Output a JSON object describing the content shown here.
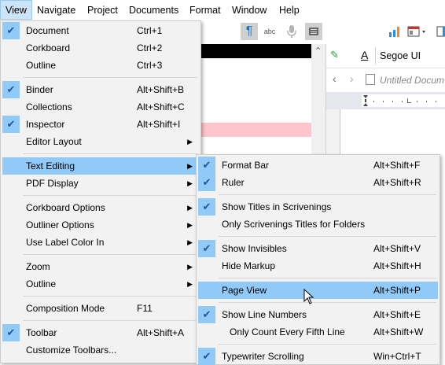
{
  "menubar": {
    "items": [
      "View",
      "Navigate",
      "Project",
      "Documents",
      "Format",
      "Window",
      "Help"
    ],
    "active": "View"
  },
  "app": {
    "font_name": "Segoe UI",
    "doc_placeholder": "Untitled Docum"
  },
  "view_menu": {
    "items": [
      {
        "label": "Document",
        "shortcut": "Ctrl+1",
        "checked": true
      },
      {
        "label": "Corkboard",
        "shortcut": "Ctrl+2"
      },
      {
        "label": "Outline",
        "shortcut": "Ctrl+3"
      },
      {
        "label": "Binder",
        "shortcut": "Alt+Shift+B",
        "checked": true
      },
      {
        "label": "Collections",
        "shortcut": "Alt+Shift+C"
      },
      {
        "label": "Inspector",
        "shortcut": "Alt+Shift+I",
        "checked": true
      },
      {
        "label": "Editor Layout",
        "submenu": true
      },
      {
        "label": "Text Editing",
        "submenu": true,
        "highlighted": true
      },
      {
        "label": "PDF Display",
        "submenu": true
      },
      {
        "label": "Corkboard Options",
        "submenu": true
      },
      {
        "label": "Outliner Options",
        "submenu": true
      },
      {
        "label": "Use Label Color In",
        "submenu": true
      },
      {
        "label": "Zoom",
        "submenu": true
      },
      {
        "label": "Outline",
        "submenu": true
      },
      {
        "label": "Composition Mode",
        "shortcut": "F11"
      },
      {
        "label": "Toolbar",
        "shortcut": "Alt+Shift+A",
        "checked": true
      },
      {
        "label": "Customize Toolbars..."
      }
    ]
  },
  "text_editing_menu": {
    "items": [
      {
        "label": "Format Bar",
        "shortcut": "Alt+Shift+F",
        "checked": true
      },
      {
        "label": "Ruler",
        "shortcut": "Alt+Shift+R",
        "checked": true
      },
      {
        "label": "Show Titles in Scrivenings",
        "checked": true
      },
      {
        "label": "Only Scrivenings Titles for Folders"
      },
      {
        "label": "Show Invisibles",
        "shortcut": "Alt+Shift+V",
        "checked": true
      },
      {
        "label": "Hide Markup",
        "shortcut": "Alt+Shift+H"
      },
      {
        "label": "Page View",
        "shortcut": "Alt+Shift+P",
        "highlighted": true
      },
      {
        "label": "Show Line Numbers",
        "shortcut": "Alt+Shift+E",
        "checked": true
      },
      {
        "label": "Only Count Every Fifth Line",
        "shortcut": "Alt+Shift+W"
      },
      {
        "label": "Typewriter Scrolling",
        "shortcut": "Win+Ctrl+T",
        "checked": true
      }
    ]
  },
  "icons": {
    "check": "✔",
    "submenu_arrow": "▶",
    "pilcrow": "¶",
    "spellcheck": "abc"
  },
  "colors": {
    "highlight": "#91c9f7",
    "menubar_active": "#cce4f7",
    "pink_row": "#ffc5cc"
  }
}
